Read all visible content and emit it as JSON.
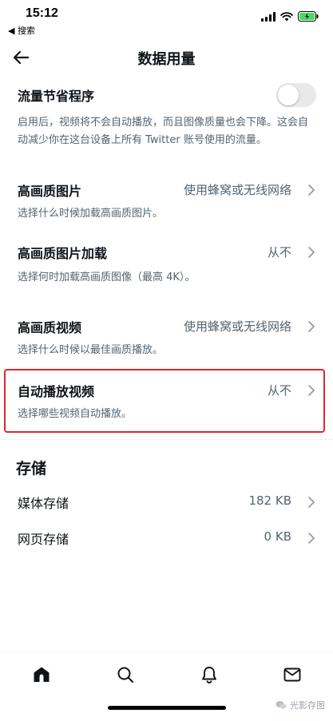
{
  "status_bar": {
    "time": "15:12",
    "back_app": "◀ 搜索"
  },
  "header": {
    "title": "数据用量"
  },
  "data_saver": {
    "title": "流量节省程序",
    "description": "启用后，视频将不会自动播放，而且图像质量也会下降。这会自动减少你在这台设备上所有 Twitter 账号使用的流量。",
    "enabled": false
  },
  "settings": [
    {
      "title": "高画质图片",
      "value": "使用蜂窝或无线网络",
      "description": "选择什么时候加载高画质图片。"
    },
    {
      "title": "高画质图片加载",
      "value": "从不",
      "description": "选择何时加载高画质图像（最高 4K）。"
    },
    {
      "title": "高画质视频",
      "value": "使用蜂窝或无线网络",
      "description": "选择什么时候以最佳画质播放。"
    },
    {
      "title": "自动播放视频",
      "value": "从不",
      "description": "选择哪些视频自动播放。"
    }
  ],
  "storage": {
    "heading": "存储",
    "items": [
      {
        "title": "媒体存储",
        "value": "182 KB"
      },
      {
        "title": "网页存储",
        "value": "0 KB"
      }
    ]
  },
  "nav": [
    "home-icon",
    "search-icon",
    "notifications-icon",
    "messages-icon"
  ],
  "watermark": "光影存图",
  "colors": {
    "highlight": "#e0272c",
    "secondary_text": "#536471"
  }
}
